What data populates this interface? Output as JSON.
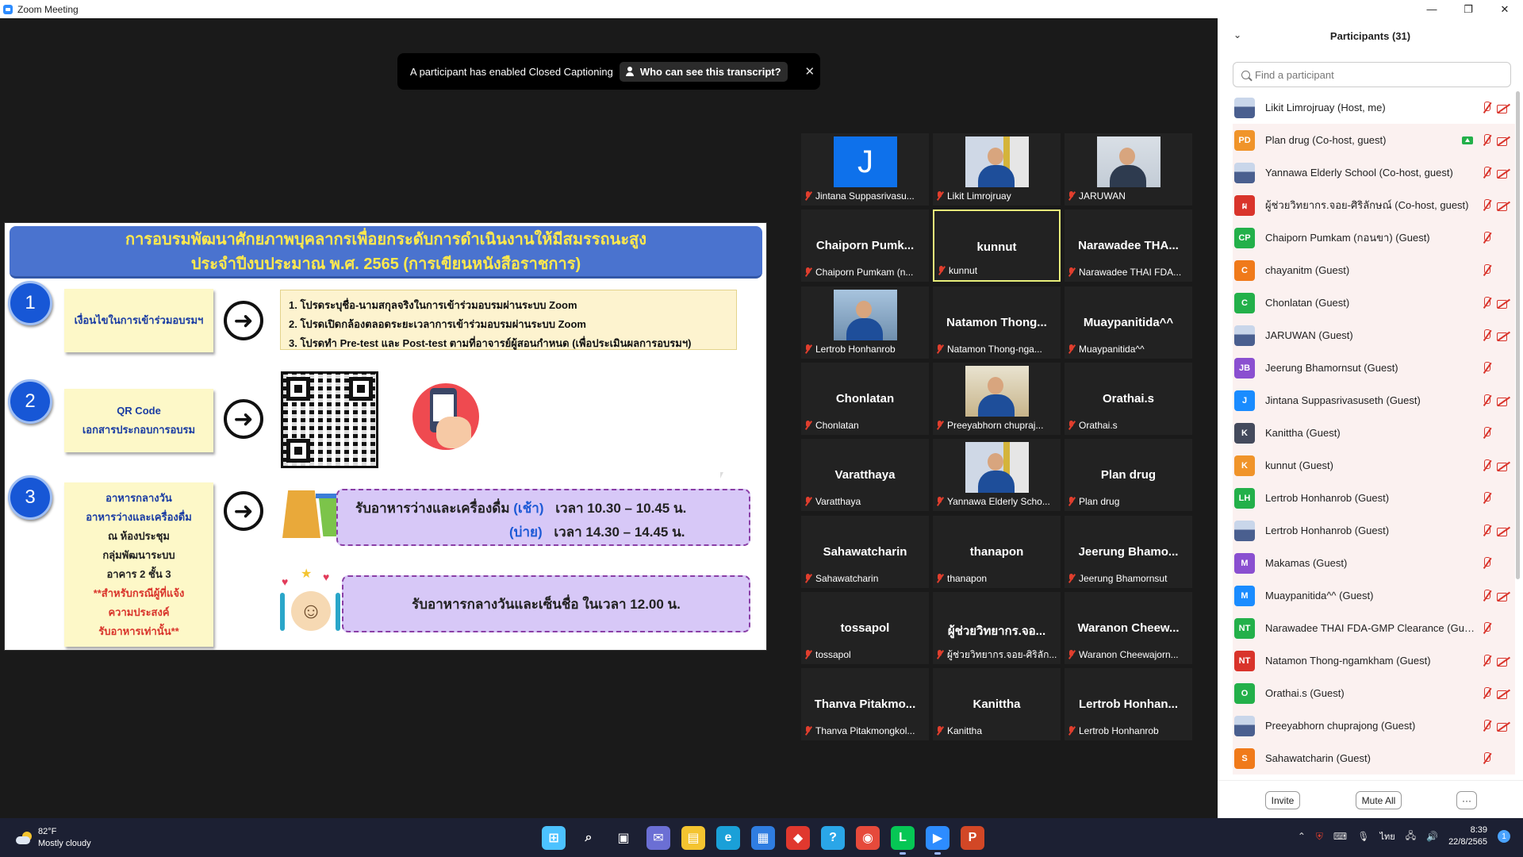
{
  "window": {
    "title": "Zoom Meeting",
    "min": "—",
    "max": "❐",
    "close": "✕"
  },
  "banner": {
    "message": "A participant has enabled Closed Captioning",
    "who": "Who can see this transcript?",
    "close": "✕"
  },
  "slide": {
    "title_line1": "การอบรมพัฒนาศักยภาพบุคลากรเพื่อยกระดับการดำเนินงานให้มีสมรรถนะสูง",
    "title_line2": "ประจำปีงบประมาณ พ.ศ. 2565 (การเขียนหนังสือราชการ)",
    "step1": {
      "num": "1",
      "label": "เงื่อนไขในการเข้าร่วมอบรมฯ",
      "items": [
        "1. โปรดระบุชื่อ-นามสกุลจริงในการเข้าร่วมอบรมผ่านระบบ Zoom",
        "2. โปรดเปิดกล้องตลอดระยะเวลาการเข้าร่วมอบรมผ่านระบบ Zoom",
        "3. โปรดทำ Pre-test และ Post-test ตามที่อาจารย์ผู้สอนกำหนด (เพื่อประเมินผลการอบรมฯ)"
      ]
    },
    "step2": {
      "num": "2",
      "label_line1": "QR Code",
      "label_line2": "เอกสารประกอบการอบรม"
    },
    "step3": {
      "num": "3",
      "label_lines": [
        "อาหารกลางวัน",
        "อาหารว่างและเครื่องดื่ม",
        "ณ ห้องประชุม",
        "กลุ่มพัฒนาระบบ",
        "อาคาร 2 ชั้น 3"
      ],
      "note_lines": [
        "**สำหรับกรณีผู้ที่แจ้ง",
        "ความประสงค์",
        "รับอาหารเท่านั้น**"
      ],
      "snack_label": "รับอาหารว่างและเครื่องดื่ม",
      "snack_morning": "(เช้า)",
      "snack_morning_time": "เวลา 10.30 – 10.45 น.",
      "snack_afternoon": "(บ่าย)",
      "snack_afternoon_time": "เวลา 14.30 – 14.45 น.",
      "lunch": "รับอาหารกลางวันและเซ็นชื่อ ในเวลา 12.00 น."
    }
  },
  "gallery": [
    {
      "big": "",
      "label": "Jintana Suppasrivasu...",
      "video": "J"
    },
    {
      "big": "",
      "label": "Likit Limrojruay",
      "video": "man-flag"
    },
    {
      "big": "",
      "label": "JARUWAN",
      "video": "woman"
    },
    {
      "big": "Chaiporn  Pumk...",
      "label": "Chaiporn Pumkam (n..."
    },
    {
      "big": "kunnut",
      "label": "kunnut",
      "active": true
    },
    {
      "big": "Narawadee  THA...",
      "label": "Narawadee THAI FDA..."
    },
    {
      "big": "",
      "label": "Lertrob Honhanrob",
      "video": "city"
    },
    {
      "big": "Natamon  Thong...",
      "label": "Natamon Thong-nga..."
    },
    {
      "big": "Muaypanitida^^",
      "label": "Muaypanitida^^"
    },
    {
      "big": "Chonlatan",
      "label": "Chonlatan"
    },
    {
      "big": "",
      "label": "Preeyabhorn chupraj...",
      "video": "room"
    },
    {
      "big": "Orathai.s",
      "label": "Orathai.s"
    },
    {
      "big": "Varatthaya",
      "label": "Varatthaya"
    },
    {
      "big": "",
      "label": "Yannawa Elderly Scho...",
      "video": "man-flag"
    },
    {
      "big": "Plan drug",
      "label": "Plan drug"
    },
    {
      "big": "Sahawatcharin",
      "label": "Sahawatcharin"
    },
    {
      "big": "thanapon",
      "label": "thanapon"
    },
    {
      "big": "Jeerung  Bhamo...",
      "label": "Jeerung Bhamornsut"
    },
    {
      "big": "tossapol",
      "label": "tossapol"
    },
    {
      "big": "ผู้ช่วยวิทยากร.จอ...",
      "label": "ผู้ช่วยวิทยากร.จอย-ศิริลัก..."
    },
    {
      "big": "Waranon  Cheew...",
      "label": "Waranon Cheewajorn..."
    },
    {
      "big": "Thanva  Pitakmo...",
      "label": "Thanva Pitakmongkol..."
    },
    {
      "big": "Kanittha",
      "label": "Kanittha"
    },
    {
      "big": "Lertrob  Honhan...",
      "label": "Lertrob Honhanrob"
    }
  ],
  "panel": {
    "title": "Participants (31)",
    "search_placeholder": "Find a participant",
    "participants": [
      {
        "name": "Likit Limrojruay (Host, me)",
        "avatar": "",
        "color": "photo",
        "cam": true
      },
      {
        "name": "Plan drug (Co-host, guest)",
        "avatar": "PD",
        "color": "#f0942a",
        "cam": true,
        "share": true
      },
      {
        "name": "Yannawa Elderly School (Co-host, guest)",
        "avatar": "",
        "color": "photo",
        "cam": true
      },
      {
        "name": "ผู้ช่วยวิทยากร.จอย-ศิริลักษณ์ (Co-host, guest)",
        "avatar": "ผ",
        "color": "#d9342b",
        "cam": true
      },
      {
        "name": "Chaiporn Pumkam (กอนขา) (Guest)",
        "avatar": "CP",
        "color": "#23b04a",
        "cam": false
      },
      {
        "name": "chayanitm (Guest)",
        "avatar": "C",
        "color": "#f07a1a",
        "cam": false
      },
      {
        "name": "Chonlatan (Guest)",
        "avatar": "C",
        "color": "#23b04a",
        "cam": true
      },
      {
        "name": "JARUWAN (Guest)",
        "avatar": "",
        "color": "photo",
        "cam": true
      },
      {
        "name": "Jeerung Bhamornsut (Guest)",
        "avatar": "JB",
        "color": "#8a4fd0",
        "cam": false
      },
      {
        "name": "Jintana Suppasrivasuseth (Guest)",
        "avatar": "J",
        "color": "#1a8cff",
        "cam": true
      },
      {
        "name": "Kanittha (Guest)",
        "avatar": "K",
        "color": "#444a5c",
        "cam": false
      },
      {
        "name": "kunnut (Guest)",
        "avatar": "K",
        "color": "#f0942a",
        "cam": true
      },
      {
        "name": "Lertrob Honhanrob (Guest)",
        "avatar": "LH",
        "color": "#23b04a",
        "cam": false
      },
      {
        "name": "Lertrob Honhanrob (Guest)",
        "avatar": "",
        "color": "photo",
        "cam": true
      },
      {
        "name": "Makamas (Guest)",
        "avatar": "M",
        "color": "#8a4fd0",
        "cam": false
      },
      {
        "name": "Muaypanitida^^ (Guest)",
        "avatar": "M",
        "color": "#1a8cff",
        "cam": true
      },
      {
        "name": "Narawadee THAI FDA-GMP Clearance (Guest)",
        "avatar": "NT",
        "color": "#23b04a",
        "cam": false
      },
      {
        "name": "Natamon Thong-ngamkham (Guest)",
        "avatar": "NT",
        "color": "#d9342b",
        "cam": true
      },
      {
        "name": "Orathai.s (Guest)",
        "avatar": "O",
        "color": "#23b04a",
        "cam": true
      },
      {
        "name": "Preeyabhorn chuprajong (Guest)",
        "avatar": "",
        "color": "photo",
        "cam": true
      },
      {
        "name": "Sahawatcharin (Guest)",
        "avatar": "S",
        "color": "#f07a1a",
        "cam": false
      }
    ],
    "invite": "Invite",
    "mute_all": "Mute All",
    "more": "···"
  },
  "taskbar": {
    "temp": "82°F",
    "weather": "Mostly cloudy",
    "time": "8:39",
    "date": "22/8/2565",
    "lang": "ไทย",
    "notifications": "1",
    "apps": [
      "start-icon",
      "search-icon",
      "task-view-icon",
      "teams-chat-icon",
      "file-explorer-icon",
      "edge-icon",
      "store-icon",
      "anydesk-icon",
      "help-icon",
      "chrome-icon",
      "line-icon",
      "zoom-icon",
      "powerpoint-icon"
    ]
  }
}
